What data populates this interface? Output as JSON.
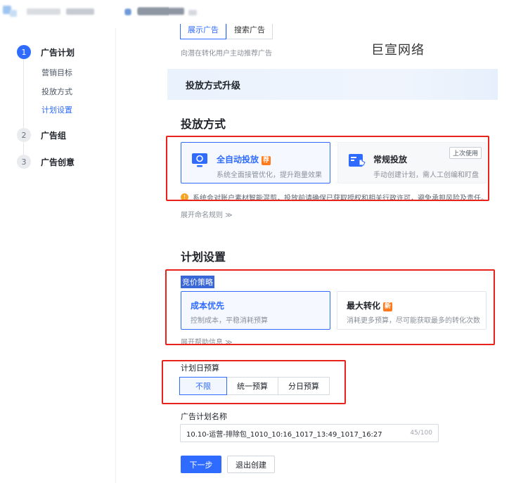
{
  "steps": [
    {
      "num": "1",
      "title": "广告计划"
    },
    {
      "num": "2",
      "title": "广告组"
    },
    {
      "num": "3",
      "title": "广告创意"
    }
  ],
  "substeps": [
    "营销目标",
    "投放方式",
    "计划设置"
  ],
  "top_toggle": {
    "options": [
      "展示广告",
      "搜索广告"
    ],
    "hint": "向潜在转化用户主动推荐广告"
  },
  "watermark": "巨宣网络",
  "upgrade_title": "投放方式升级",
  "delivery": {
    "heading": "投放方式",
    "options": [
      {
        "title": "全自动投放",
        "badge": "荐",
        "desc": "系统全面接管优化，提升跑量效果"
      },
      {
        "title": "常规投放",
        "tag": "上次使用",
        "desc": "手动创建计划，需人工创编和盯盘"
      }
    ],
    "warning": "系统会对账户素材智能混剪，投放前请确保已获取授权和相关行政许可，避免承担风险及责任。",
    "expand": "展开命名规则 ≫"
  },
  "plan": {
    "heading": "计划设置",
    "bid_label": "竞价策略",
    "bid_options": [
      {
        "title": "成本优先",
        "desc": "控制成本，平稳消耗预算"
      },
      {
        "title": "最大转化",
        "badge": "新",
        "desc": "消耗更多预算，尽可能获取最多的转化次数"
      }
    ],
    "expand": "展开帮助信息 ≫",
    "budget_label": "计划日预算",
    "budget_options": [
      "不限",
      "统一预算",
      "分日预算"
    ],
    "name_label": "广告计划名称",
    "name_value": "10.10-运营-排除包_1010_10:16_1017_13:49_1017_16:27",
    "name_count": "45/100"
  },
  "buttons": {
    "next": "下一步",
    "exit": "退出创建"
  },
  "colors": {
    "accent": "#2f6bff",
    "annotation_red": "#e8231c",
    "badge_orange": "#ff7a1a"
  }
}
